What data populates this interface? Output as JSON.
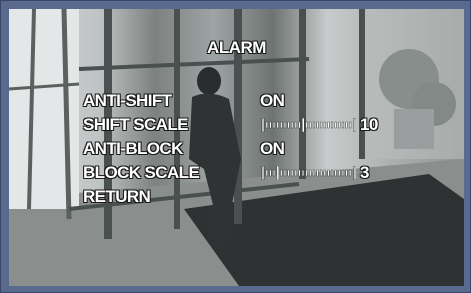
{
  "menu": {
    "title": "ALARM",
    "items": [
      {
        "label": "ANTI-SHIFT",
        "value": "ON"
      },
      {
        "label": "SHIFT SCALE",
        "slider_value": "10",
        "level": 10,
        "max": 24
      },
      {
        "label": "ANTI-BLOCK",
        "value": "ON"
      },
      {
        "label": "BLOCK SCALE",
        "slider_value": "3",
        "level": 3,
        "max": 24
      },
      {
        "label": "RETURN"
      }
    ]
  },
  "colors": {
    "frame": "#5a6a8f",
    "text": "#ffffff"
  }
}
